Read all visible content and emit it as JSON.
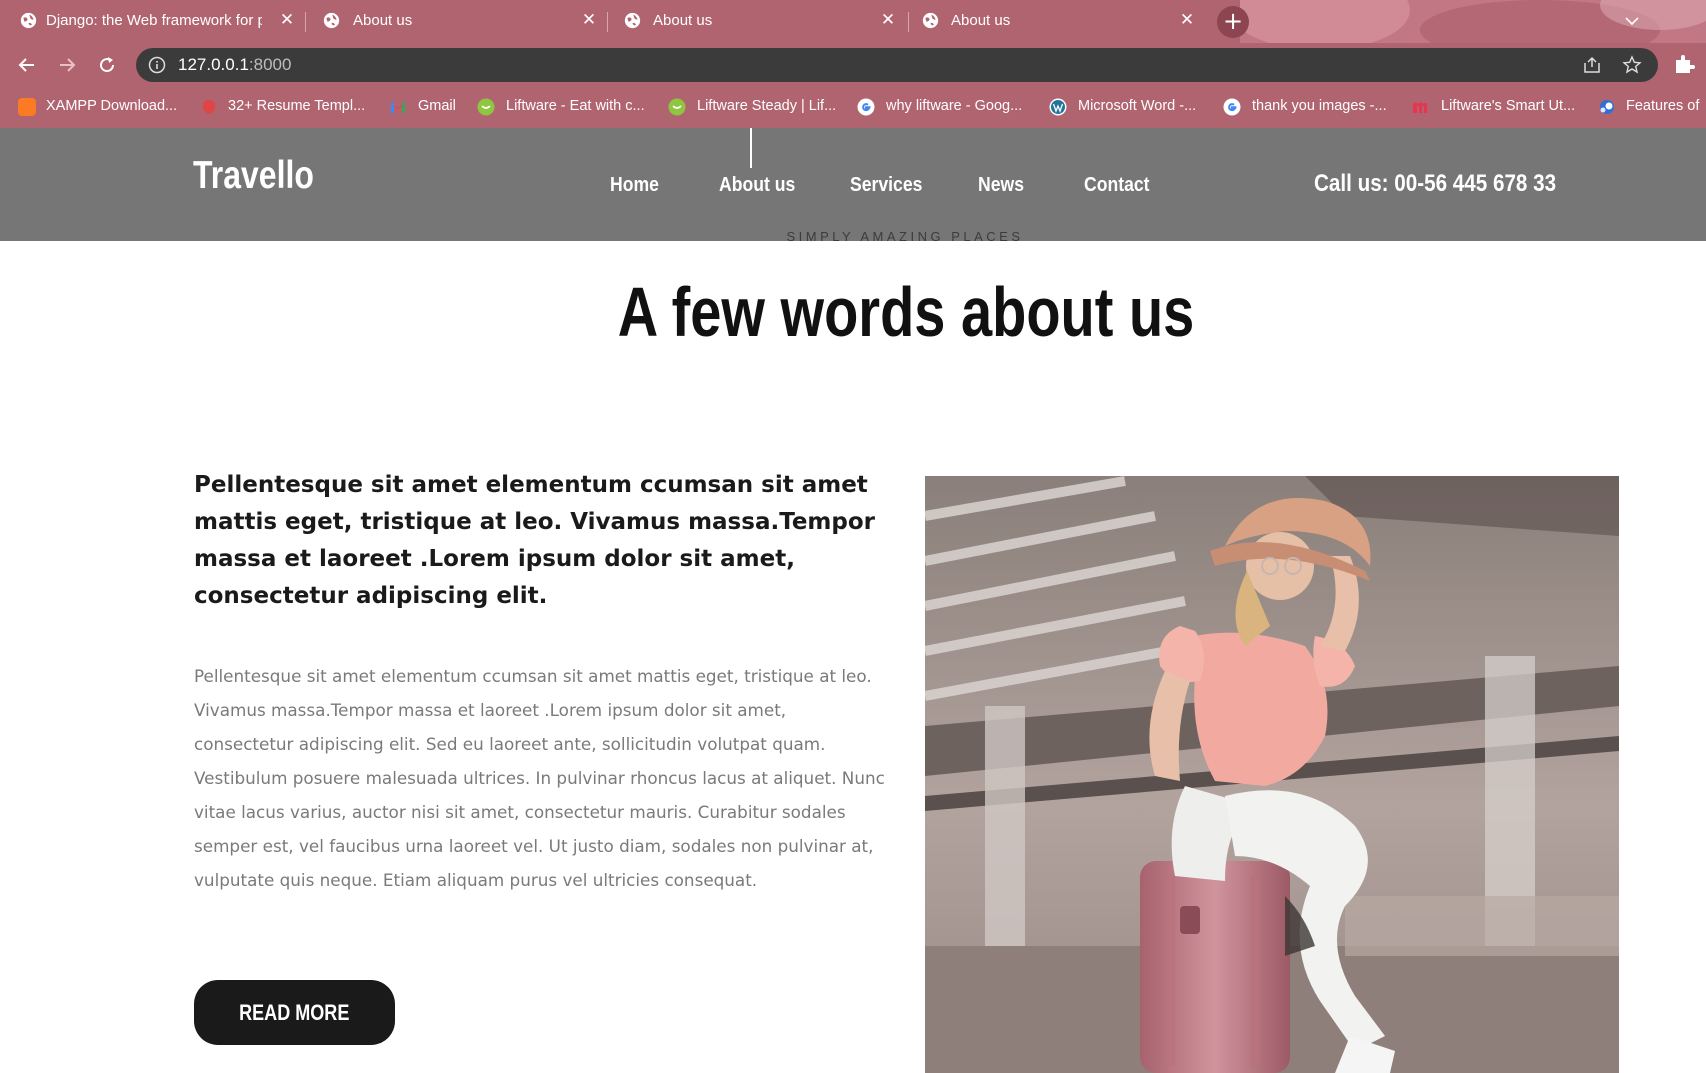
{
  "browser": {
    "tabs": [
      {
        "title": "Django: the Web framework for p",
        "active": false
      },
      {
        "title": "About us",
        "active": false
      },
      {
        "title": "About us",
        "active": false
      },
      {
        "title": "About us",
        "active": true
      }
    ],
    "new_tab_label": "+",
    "url_host": "127.0.0.1",
    "url_port": ":8000",
    "bookmarks": [
      {
        "label": "XAMPP Download...",
        "icon": "xampp-icon",
        "color": "#fb7a24"
      },
      {
        "label": "32+ Resume Templ...",
        "icon": "resume-icon",
        "color": "#e04545"
      },
      {
        "label": "Gmail",
        "icon": "gmail-icon",
        "color": "#ea4335"
      },
      {
        "label": "Liftware - Eat with c...",
        "icon": "liftware-icon",
        "color": "#8ec63f"
      },
      {
        "label": "Liftware Steady | Lif...",
        "icon": "liftware-icon",
        "color": "#8ec63f"
      },
      {
        "label": "why liftware - Goog...",
        "icon": "google-icon",
        "color": "#4285f4"
      },
      {
        "label": "Microsoft Word -...",
        "icon": "wordpress-icon",
        "color": "#21759b"
      },
      {
        "label": "thank you images -...",
        "icon": "google-icon",
        "color": "#4285f4"
      },
      {
        "label": "Liftware's Smart Ut...",
        "icon": "m-icon",
        "color": "#e8344e"
      },
      {
        "label": "Features of",
        "icon": "edge-icon",
        "color": "#2f6fd6"
      }
    ]
  },
  "site": {
    "logo": "Travello",
    "nav": [
      "Home",
      "About us",
      "Services",
      "News",
      "Contact"
    ],
    "active_nav": "About us",
    "call": "Call us: 00-56 445 678 33",
    "header_bg": "#767676"
  },
  "about": {
    "tagline": "SIMPLY AMAZING PLACES",
    "heading": "A few words about us",
    "lead": "Pellentesque sit amet elementum ccumsan sit amet mattis eget, tristique at leo. Vivamus massa.Tempor massa et laoreet .Lorem ipsum dolor sit amet, consectetur adipiscing elit.",
    "body": "Pellentesque sit amet elementum ccumsan sit amet mattis eget, tristique at leo. Vivamus massa.Tempor massa et laoreet .Lorem ipsum dolor sit amet, consectetur adipiscing elit. Sed eu laoreet ante, sollicitudin volutpat quam. Vestibulum posuere malesuada ultrices. In pulvinar rhoncus lacus at aliquet. Nunc vitae lacus varius, auctor nisi sit amet, consectetur mauris. Curabitur sodales semper est, vel faucibus urna laoreet vel. Ut justo diam, sodales non pulvinar at, vulputate quis neque. Etiam aliquam purus vel ultricies consequat.",
    "button": "READ MORE"
  },
  "colors": {
    "chrome": "#b06470",
    "omnibox": "#3b3b3b",
    "button": "#1a1a1a"
  }
}
